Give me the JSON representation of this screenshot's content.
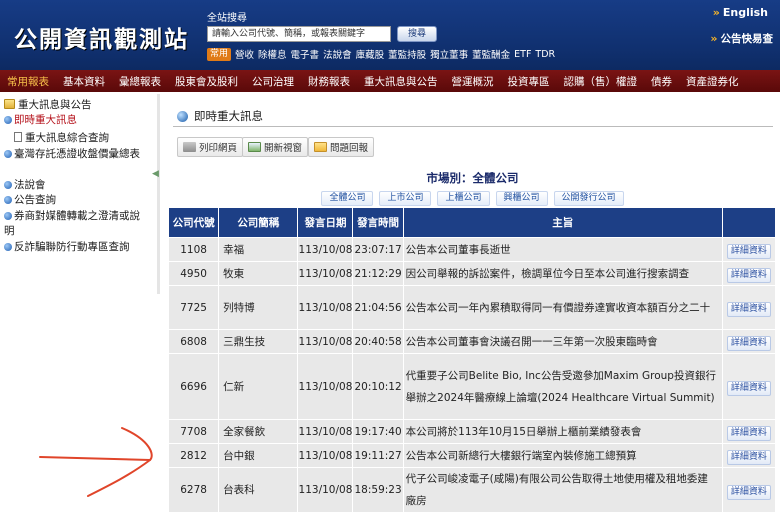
{
  "header": {
    "site_title": "公開資訊觀測站",
    "search_title": "全站搜尋",
    "search_placeholder": "請輸入公司代號、簡稱，或報表關鍵字",
    "search_button": "搜尋",
    "common_chip": "常用",
    "quick_links": [
      "營收",
      "除權息",
      "電子書",
      "法說會",
      "庫藏股",
      "董監持股",
      "獨立董事",
      "董監酬金",
      "ETF",
      "TDR"
    ],
    "english": "English",
    "quick_search": "公告快易查"
  },
  "nav": {
    "items": [
      "常用報表",
      "基本資料",
      "彙總報表",
      "股東會及股利",
      "公司治理",
      "財務報表",
      "重大訊息與公告",
      "營運概況",
      "投資專區",
      "認購（售）權證",
      "債券",
      "資產證券化"
    ],
    "active_index": 0
  },
  "sidebar": {
    "items": [
      {
        "label": "重大訊息與公告",
        "icon": "folder-icon"
      },
      {
        "label": "即時重大訊息",
        "icon": "bullet-icon",
        "active": true
      },
      {
        "label": "重大訊息綜合查詢",
        "icon": "doc-icon"
      },
      {
        "label": "臺灣存託憑證收盤價彙總表",
        "icon": "bullet-icon"
      },
      {
        "label": "法說會",
        "icon": "bullet-icon"
      },
      {
        "label": "公告查詢",
        "icon": "bullet-icon"
      },
      {
        "label": "券商對媒體轉載之澄清或說明",
        "icon": "bullet-icon"
      },
      {
        "label": "反詐騙聯防行動專區查詢",
        "icon": "bullet-icon"
      }
    ]
  },
  "main": {
    "title": "即時重大訊息",
    "toolbar": {
      "print": "列印網頁",
      "new_window": "開新視窗",
      "feedback": "問題回報"
    },
    "market_label": "市場別：全體公司",
    "market_tabs": [
      "全體公司",
      "上市公司",
      "上櫃公司",
      "興櫃公司",
      "公開發行公司"
    ],
    "table": {
      "headers": [
        "公司代號",
        "公司簡稱",
        "發言日期",
        "發言時間",
        "主旨"
      ],
      "detail_label": "詳細資料",
      "rows": [
        {
          "code": "1108",
          "name": "幸福",
          "date": "113/10/08",
          "time": "23:07:17",
          "subject": "公告本公司董事長逝世"
        },
        {
          "code": "4950",
          "name": "牧東",
          "date": "113/10/08",
          "time": "21:12:29",
          "subject": "因公司舉報的訴訟案件，檢調單位今日至本公司進行搜索調查"
        },
        {
          "code": "7725",
          "name": "列特博",
          "date": "113/10/08",
          "time": "21:04:56",
          "subject": "公告本公司一年內累積取得同一有價證券達實收資本額百分之二十"
        },
        {
          "code": "6808",
          "name": "三鼎生技",
          "date": "113/10/08",
          "time": "20:40:58",
          "subject": "公告本公司董事會決議召開一一三年第一次股東臨時會"
        },
        {
          "code": "6696",
          "name": "仁新",
          "date": "113/10/08",
          "time": "20:10:12",
          "subject": "代重要子公司Belite Bio, Inc公告受邀參加Maxim Group投資銀行 舉辦之2024年醫療線上論壇(2024 Healthcare Virtual Summit)"
        },
        {
          "code": "7708",
          "name": "全家餐飲",
          "date": "113/10/08",
          "time": "19:17:40",
          "subject": "本公司將於113年10月15日舉辦上櫃前業績發表會"
        },
        {
          "code": "2812",
          "name": "台中銀",
          "date": "113/10/08",
          "time": "19:11:27",
          "subject": "公告本公司新總行大樓銀行端室內裝修施工總預算"
        },
        {
          "code": "6278",
          "name": "台表科",
          "date": "113/10/08",
          "time": "18:59:23",
          "subject": "代子公司峻凌電子(咸陽)有限公司公告取得土地使用權及租地委建 廠房"
        }
      ]
    }
  },
  "colors": {
    "header_blue": "#173c86",
    "nav_red": "#7a1414",
    "table_header": "#1d3f86",
    "row_bg": "#e8e8e8",
    "annotation_arrow": "#e0452a"
  }
}
